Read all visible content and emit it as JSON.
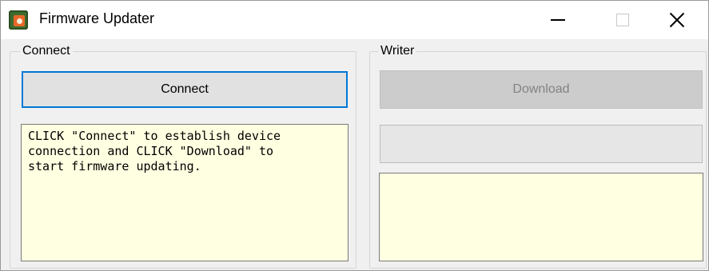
{
  "window": {
    "title": "Firmware Updater",
    "app_icon": "firmware-updater-app-icon",
    "controls": [
      "minimize-icon",
      "maximize-icon",
      "close-icon"
    ]
  },
  "connect_group": {
    "label": "Connect",
    "button_label": "Connect",
    "message": "CLICK \"Connect\" to establish device\nconnection and CLICK \"Download\" to\nstart firmware updating."
  },
  "writer_group": {
    "label": "Writer",
    "download_label": "Download",
    "download_enabled": false,
    "progress": 0,
    "log": ""
  },
  "colors": {
    "focus_border": "#0078d7",
    "textbox_bg": "#ffffe1",
    "disabled_text": "#838383"
  }
}
